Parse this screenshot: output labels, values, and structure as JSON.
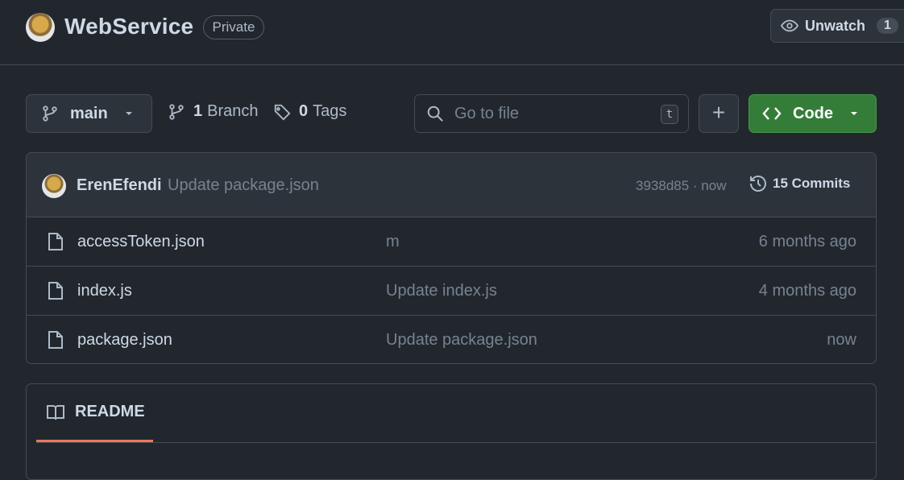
{
  "repo": {
    "name": "WebService",
    "visibility": "Private"
  },
  "watch": {
    "label": "Unwatch",
    "count": "1"
  },
  "toolbar": {
    "branch": "main",
    "branch_count": "1",
    "branch_label": "Branch",
    "tag_count": "0",
    "tag_label": "Tags",
    "search_placeholder": "Go to file",
    "search_shortcut": "t",
    "add_label": "+",
    "code_label": "Code"
  },
  "latest_commit": {
    "author": "ErenEfendi",
    "message": "Update package.json",
    "sha_time": "3938d85 · now",
    "commits_label": "15 Commits"
  },
  "files": [
    {
      "name": "accessToken.json",
      "message": "m",
      "time": "6 months ago"
    },
    {
      "name": "index.js",
      "message": "Update index.js",
      "time": "4 months ago"
    },
    {
      "name": "package.json",
      "message": "Update package.json",
      "time": "now"
    }
  ],
  "readme": {
    "tab_label": "README"
  },
  "colors": {
    "background": "#22272e",
    "code_button": "#347d39",
    "readme_underline": "#ec775c"
  },
  "icons": {
    "branch": "git-branch-icon",
    "tag": "tag-icon",
    "search": "search-icon",
    "code": "code-icon",
    "eye": "eye-icon",
    "history": "history-icon",
    "file": "file-icon",
    "book": "book-icon"
  }
}
